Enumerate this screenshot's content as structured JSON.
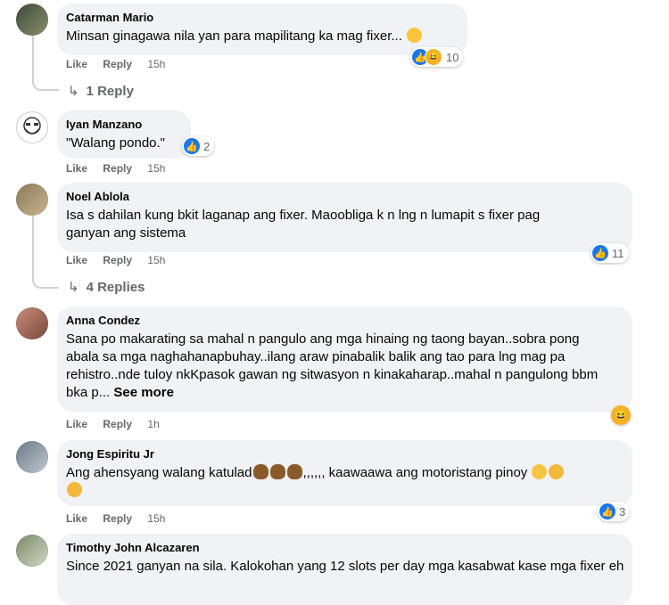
{
  "ui": {
    "like": "Like",
    "reply": "Reply",
    "see_more": "See more"
  },
  "comments": [
    {
      "author": "Catarman Mario",
      "text": "Minsan ginagawa nila yan para mapilitang ka mag fixer...",
      "time": "15h",
      "reactions": "10",
      "replies": "1 Reply"
    },
    {
      "author": "Iyan Manzano",
      "text": "\"Walang pondo.\"",
      "time": "15h",
      "reactions": "2"
    },
    {
      "author": "Noel Ablola",
      "text": "Isa s dahilan kung bkit laganap ang fixer. Maoobliga k n lng n lumapit s fixer pag ganyan ang sistema",
      "time": "15h",
      "reactions": "11",
      "replies": "4 Replies"
    },
    {
      "author": "Anna Condez",
      "text": "Sana po makarating sa mahal n pangulo ang mga hinaing ng taong bayan..sobra pong abala sa mga naghahanapbuhay..ilang araw pinabalik balik ang tao para lng mag pa rehistro..nde tuloy nkKpasok gawan ng sitwasyon n kinakaharap..mahal n pangulong bbm bka p...",
      "time": "1h"
    },
    {
      "author": "Jong Espiritu Jr",
      "text_a": "Ang ahensyang walang katulad",
      "text_b": ",,,,,, kaawaawa ang motoristang pinoy",
      "time": "15h",
      "reactions": "3"
    },
    {
      "author": "Timothy John Alcazaren",
      "text": "Since 2021 ganyan na sila. Kalokohan yang 12 slots per day mga kasabwat kase mga fixer eh"
    }
  ]
}
